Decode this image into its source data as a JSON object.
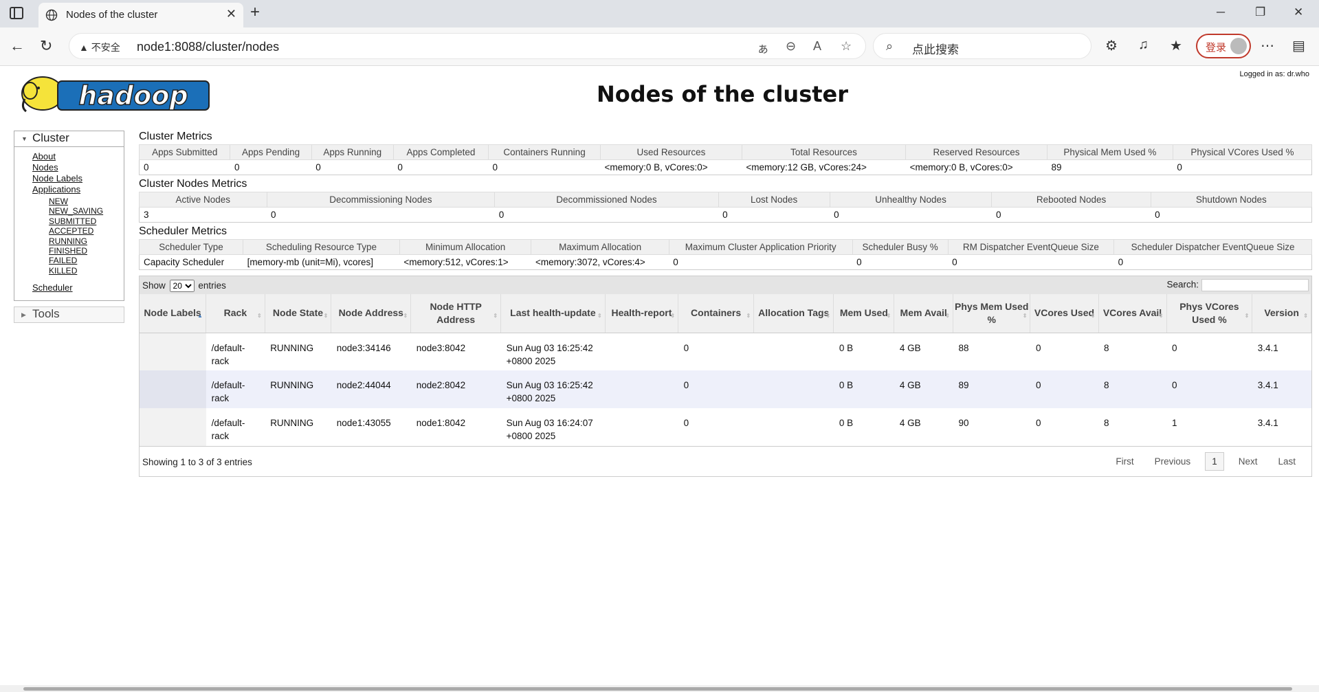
{
  "browser": {
    "tab_title": "Nodes of the cluster",
    "security_label": "不安全",
    "url": "node1:8088/cluster/nodes",
    "search_placeholder": "点此搜索",
    "login_label": "登录"
  },
  "page": {
    "title": "Nodes of the cluster",
    "logged_in": "Logged in as: dr.who"
  },
  "nav": {
    "cluster_label": "Cluster",
    "links": [
      "About",
      "Nodes",
      "Node Labels",
      "Applications"
    ],
    "app_states": [
      "NEW",
      "NEW_SAVING",
      "SUBMITTED",
      "ACCEPTED",
      "RUNNING",
      "FINISHED",
      "FAILED",
      "KILLED"
    ],
    "scheduler": "Scheduler",
    "tools_label": "Tools"
  },
  "cluster_metrics": {
    "title": "Cluster Metrics",
    "headers": [
      "Apps Submitted",
      "Apps Pending",
      "Apps Running",
      "Apps Completed",
      "Containers Running",
      "Used Resources",
      "Total Resources",
      "Reserved Resources",
      "Physical Mem Used %",
      "Physical VCores Used %"
    ],
    "values": [
      "0",
      "0",
      "0",
      "0",
      "0",
      "<memory:0 B, vCores:0>",
      "<memory:12 GB, vCores:24>",
      "<memory:0 B, vCores:0>",
      "89",
      "0"
    ]
  },
  "node_metrics": {
    "title": "Cluster Nodes Metrics",
    "headers": [
      "Active Nodes",
      "Decommissioning Nodes",
      "Decommissioned Nodes",
      "Lost Nodes",
      "Unhealthy Nodes",
      "Rebooted Nodes",
      "Shutdown Nodes"
    ],
    "values": [
      "3",
      "0",
      "0",
      "0",
      "0",
      "0",
      "0"
    ]
  },
  "scheduler_metrics": {
    "title": "Scheduler Metrics",
    "headers": [
      "Scheduler Type",
      "Scheduling Resource Type",
      "Minimum Allocation",
      "Maximum Allocation",
      "Maximum Cluster Application Priority",
      "Scheduler Busy %",
      "RM Dispatcher EventQueue Size",
      "Scheduler Dispatcher EventQueue Size"
    ],
    "values": [
      "Capacity Scheduler",
      "[memory-mb (unit=Mi), vcores]",
      "<memory:512, vCores:1>",
      "<memory:3072, vCores:4>",
      "0",
      "0",
      "0",
      "0"
    ]
  },
  "nodes_table": {
    "show_label": "Show",
    "entries_value": "20",
    "entries_label": "entries",
    "search_label": "Search:",
    "headers": [
      "Node Labels",
      "Rack",
      "Node State",
      "Node Address",
      "Node HTTP Address",
      "Last health-update",
      "Health-report",
      "Containers",
      "Allocation Tags",
      "Mem Used",
      "Mem Avail",
      "Phys Mem Used %",
      "VCores Used",
      "VCores Avail",
      "Phys VCores Used %",
      "Version"
    ],
    "rows": [
      {
        "labels": "",
        "rack": "/default-rack",
        "state": "RUNNING",
        "address": "node3:34146",
        "http": "node3:8042",
        "health_update": "Sun Aug 03 16:25:42 +0800 2025",
        "report": "",
        "containers": "0",
        "tags": "",
        "mem_used": "0 B",
        "mem_avail": "4 GB",
        "phys_mem": "88",
        "vc_used": "0",
        "vc_avail": "8",
        "phys_vc": "0",
        "version": "3.4.1"
      },
      {
        "labels": "",
        "rack": "/default-rack",
        "state": "RUNNING",
        "address": "node2:44044",
        "http": "node2:8042",
        "health_update": "Sun Aug 03 16:25:42 +0800 2025",
        "report": "",
        "containers": "0",
        "tags": "",
        "mem_used": "0 B",
        "mem_avail": "4 GB",
        "phys_mem": "89",
        "vc_used": "0",
        "vc_avail": "8",
        "phys_vc": "0",
        "version": "3.4.1"
      },
      {
        "labels": "",
        "rack": "/default-rack",
        "state": "RUNNING",
        "address": "node1:43055",
        "http": "node1:8042",
        "health_update": "Sun Aug 03 16:24:07 +0800 2025",
        "report": "",
        "containers": "0",
        "tags": "",
        "mem_used": "0 B",
        "mem_avail": "4 GB",
        "phys_mem": "90",
        "vc_used": "0",
        "vc_avail": "8",
        "phys_vc": "1",
        "version": "3.4.1"
      }
    ],
    "info": "Showing 1 to 3 of 3 entries",
    "pager": [
      "First",
      "Previous",
      "1",
      "Next",
      "Last"
    ]
  }
}
